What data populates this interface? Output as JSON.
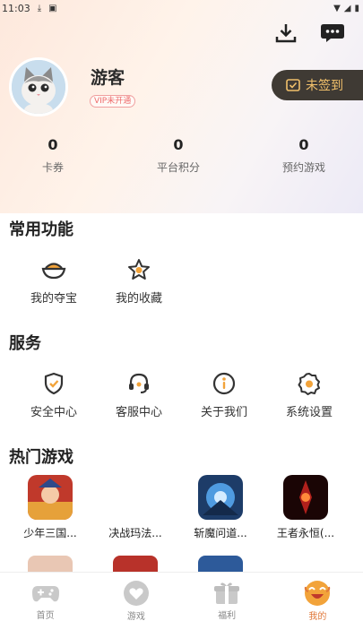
{
  "status_bar": {
    "time": "11:03"
  },
  "profile": {
    "name": "游客",
    "vip_badge": "VIP未开通"
  },
  "checkin_label": "未签到",
  "stats": [
    {
      "value": "0",
      "label": "卡券"
    },
    {
      "value": "0",
      "label": "平台积分"
    },
    {
      "value": "0",
      "label": "预约游戏"
    }
  ],
  "common": {
    "title": "常用功能",
    "items": [
      {
        "label": "我的夺宝",
        "icon": "treasure-icon"
      },
      {
        "label": "我的收藏",
        "icon": "star-icon"
      }
    ]
  },
  "services": {
    "title": "服务",
    "items": [
      {
        "label": "安全中心",
        "icon": "shield-icon"
      },
      {
        "label": "客服中心",
        "icon": "headset-icon"
      },
      {
        "label": "关于我们",
        "icon": "info-icon"
      },
      {
        "label": "系统设置",
        "icon": "gear-icon"
      }
    ]
  },
  "hot_games": {
    "title": "热门游戏",
    "items": [
      {
        "name": "少年三国...",
        "color": "#c0392b"
      },
      {
        "name": "决战玛法...",
        "color": "#ffffff"
      },
      {
        "name": "斩魔问道...",
        "color": "#2c6fb0"
      },
      {
        "name": "王者永恒(...",
        "color": "#6b0f0f"
      }
    ]
  },
  "bottom_nav": [
    {
      "label": "首页",
      "icon": "gamepad-icon"
    },
    {
      "label": "游戏",
      "icon": "heart-icon"
    },
    {
      "label": "福利",
      "icon": "gift-icon"
    },
    {
      "label": "我的",
      "icon": "smiley-icon"
    }
  ],
  "colors": {
    "accent": "#f2a33a",
    "checkin_bg": "#3f3a34",
    "checkin_text": "#f1c06b",
    "active_nav": "#e0783a"
  }
}
